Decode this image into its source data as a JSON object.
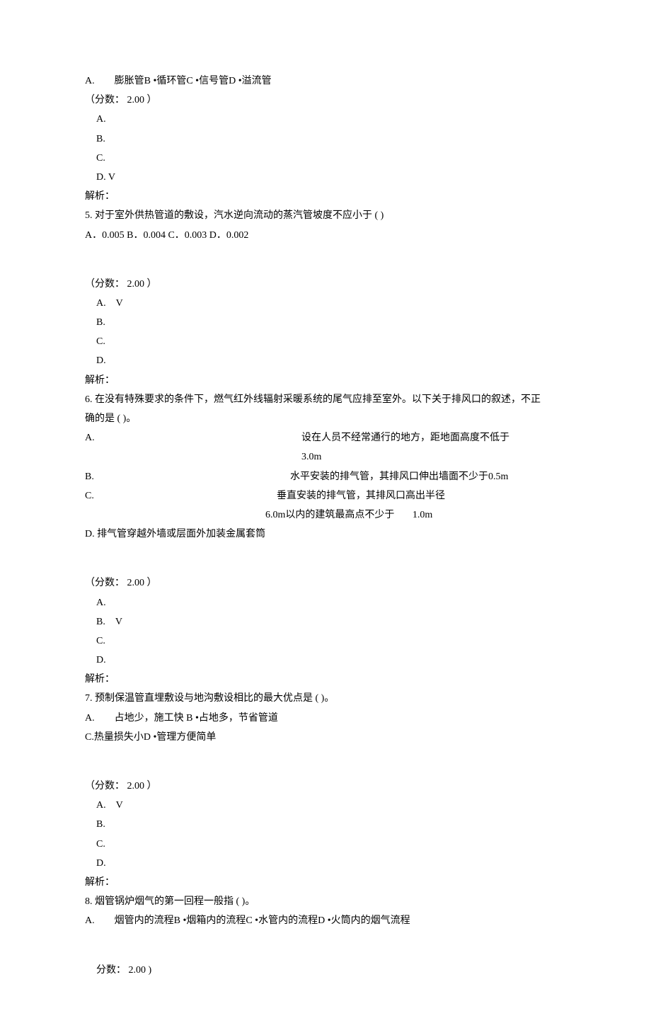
{
  "q4": {
    "optionLine": "A.　　膨胀管B •循环管C •信号管D •溢流管",
    "score": "（分数：   2.00 ）",
    "a": "A.",
    "b": "B.",
    "c": "C.",
    "d": "D. V",
    "jiexi": "解析："
  },
  "q5": {
    "stem": "5.  对于室外供热管道的敷设，汽水逆向流动的蒸汽管坡度不应小于  ( )",
    "opts": "A．0.005 B．0.004 C．0.003 D．0.002",
    "score": "（分数：   2.00 ）",
    "a": "A.　V",
    "b": "B.",
    "c": "C.",
    "d": "D.",
    "jiexi": "解析："
  },
  "q6": {
    "stem1": "6.  在没有特殊要求的条件下，燃气红外线辐射采暖系统的尾气应排至室外。以下关于排风口的叙述，不正",
    "stem2": "确的是  ( )。",
    "lineA_left": "A.",
    "lineA_right": "设在人员不经常通行的地方，距地面高度不低于",
    "lineA_2": "3.0m",
    "lineB_left": "B.",
    "lineB_right": "水平安装的排气管，其排风口伸出墙面不少于0.5m",
    "lineC_left": "C.",
    "lineC_right": "垂直安装的排气管，其排风口高出半径",
    "lineC_2_left": "6.0m以内的建筑最高点不少于",
    "lineC_2_right": "1.0m",
    "lineD": "D.  排气管穿越外墙或层面外加装金属套筒",
    "score": "（分数：   2.00 ）",
    "a": "A.",
    "b": "B.　V",
    "c": "C.",
    "d": "D.",
    "jiexi": "解析："
  },
  "q7": {
    "stem": "7.  预制保温管直埋敷设与地沟敷设相比的最大优点是  ( )。",
    "opts1": "A.　　占地少，施工快  B •占地多，节省管道",
    "opts2": "C.热量损失小D •管理方便简单",
    "score": "（分数：   2.00 ）",
    "a": "A.　V",
    "b": "B.",
    "c": "C.",
    "d": "D.",
    "jiexi": "解析："
  },
  "q8": {
    "stem": "8.  烟管锅炉烟气的第一回程一般指  ( )。",
    "opts": "A.　　烟管内的流程B •烟箱内的流程C •水管内的流程D •火筒内的烟气流程",
    "score": "分数：   2.00 )"
  }
}
